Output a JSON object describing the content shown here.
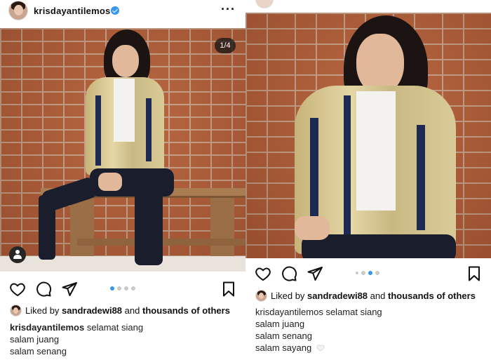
{
  "left_post": {
    "username": "krisdayantilemos",
    "verified": true,
    "more_icon": "more-horizontal-icon",
    "image_counter": "1/4",
    "carousel": {
      "total": 4,
      "active": 1
    },
    "likes": {
      "prefix": "Liked by",
      "user": "sandradewi88",
      "middle": "and",
      "rest": "thousands of others"
    },
    "caption": {
      "username": "krisdayantilemos",
      "lines": [
        "selamat siang",
        "salam juang",
        "salam senang"
      ]
    }
  },
  "right_post": {
    "carousel": {
      "total": 4,
      "active": 3
    },
    "likes": {
      "prefix": "Liked by",
      "user": "sandradewi88",
      "middle": "and",
      "rest": "thousands of others"
    },
    "caption": {
      "username": "krisdayantilemos",
      "lines": [
        "selamat siang",
        "salam juang",
        "salam senang",
        "salam sayang"
      ]
    }
  },
  "icons": {
    "like": "heart-icon",
    "comment": "comment-icon",
    "share": "send-icon",
    "save": "bookmark-icon",
    "tag": "user-tag-icon",
    "verified": "verified-badge-icon"
  },
  "colors": {
    "accent": "#3897f0",
    "text": "#111111",
    "dot_inactive": "#c9c9c9"
  }
}
